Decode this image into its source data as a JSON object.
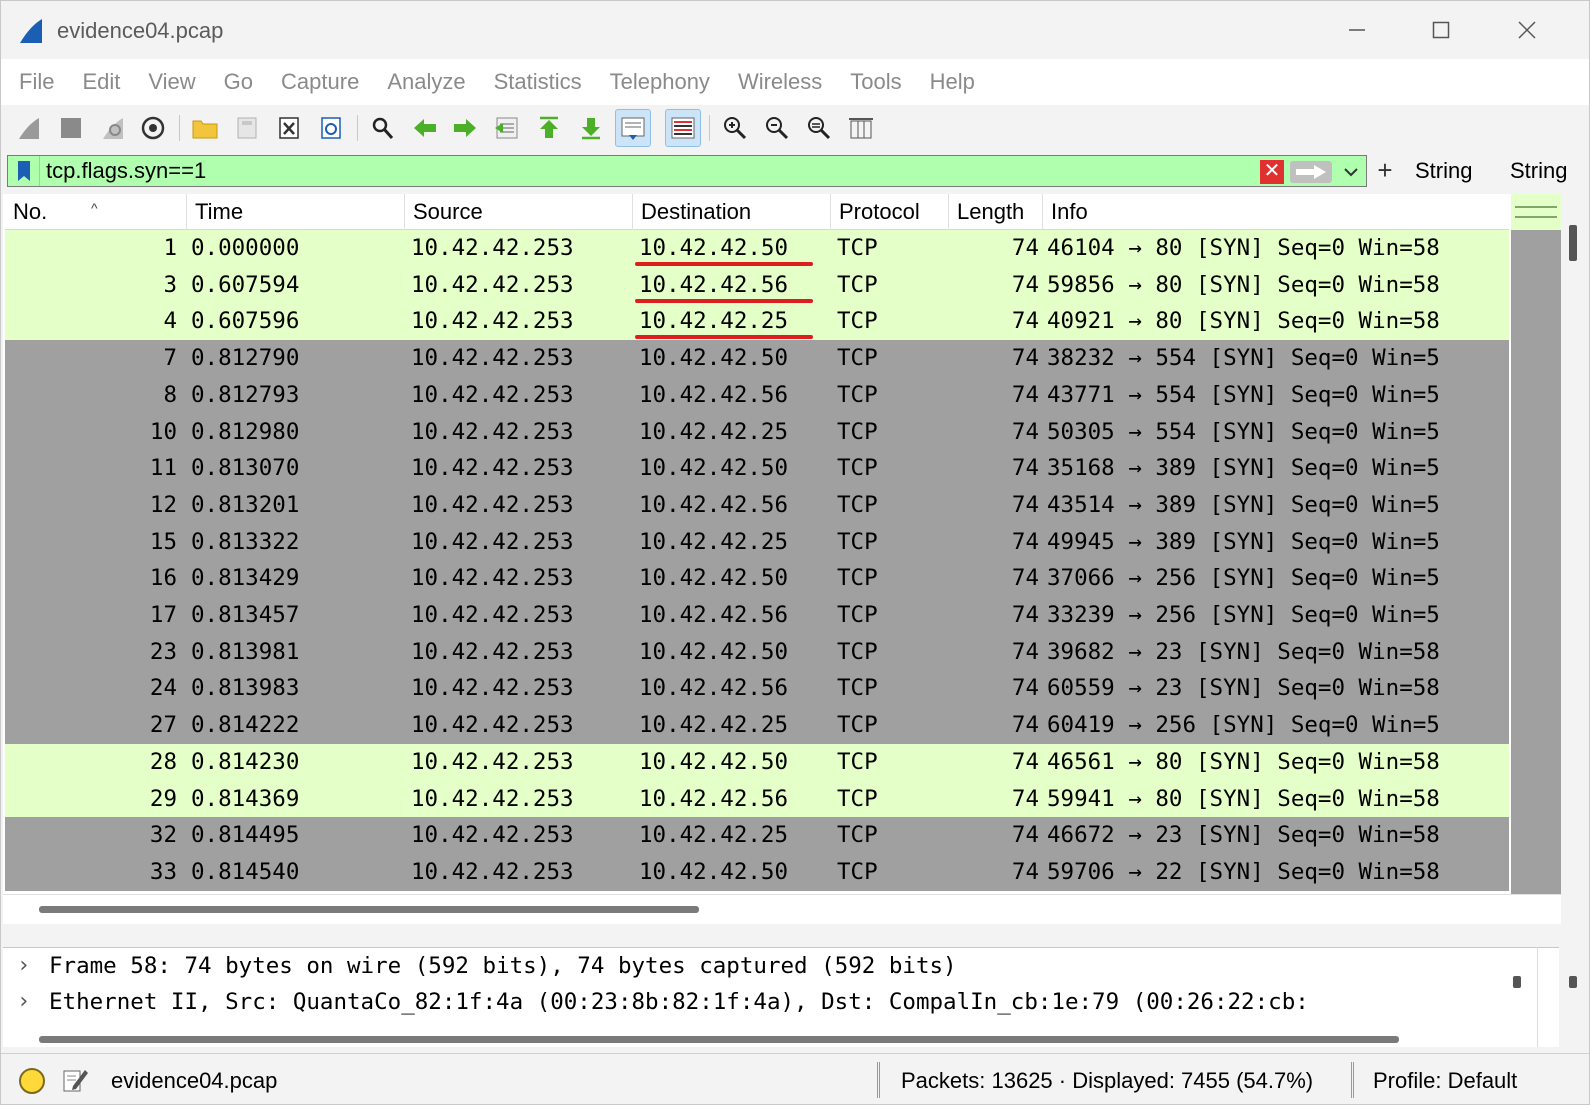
{
  "window": {
    "title": "evidence04.pcap"
  },
  "menu": [
    "File",
    "Edit",
    "View",
    "Go",
    "Capture",
    "Analyze",
    "Statistics",
    "Telephony",
    "Wireless",
    "Tools",
    "Help"
  ],
  "toolbar": {
    "icons": [
      "start-capture-icon",
      "stop-capture-icon",
      "restart-capture-icon",
      "capture-options-icon",
      "open-file-icon",
      "save-file-icon",
      "close-file-icon",
      "reload-file-icon",
      "find-packet-icon",
      "go-back-icon",
      "go-forward-icon",
      "go-to-packet-icon",
      "first-packet-icon",
      "last-packet-icon",
      "auto-scroll-icon",
      "colorize-icon",
      "zoom-in-icon",
      "zoom-out-icon",
      "normal-size-icon",
      "resize-columns-icon"
    ]
  },
  "filter": {
    "value": "tcp.flags.syn==1",
    "clear_symbol": "✕",
    "plus": "+",
    "buttons": [
      "String",
      "String"
    ]
  },
  "columns": [
    "No.",
    "Time",
    "Source",
    "Destination",
    "Protocol",
    "Length",
    "Info"
  ],
  "packets": [
    {
      "no": "1",
      "time": "0.000000",
      "src": "10.42.42.253",
      "dst": "10.42.42.50",
      "proto": "TCP",
      "len": "74",
      "info": "46104 → 80 [SYN] Seq=0 Win=58",
      "color": "light-green",
      "dst_underlined": true
    },
    {
      "no": "3",
      "time": "0.607594",
      "src": "10.42.42.253",
      "dst": "10.42.42.56",
      "proto": "TCP",
      "len": "74",
      "info": "59856 → 80 [SYN] Seq=0 Win=58",
      "color": "light-green",
      "dst_underlined": true
    },
    {
      "no": "4",
      "time": "0.607596",
      "src": "10.42.42.253",
      "dst": "10.42.42.25",
      "proto": "TCP",
      "len": "74",
      "info": "40921 → 80 [SYN] Seq=0 Win=58",
      "color": "light-green",
      "dst_underlined": true
    },
    {
      "no": "7",
      "time": "0.812790",
      "src": "10.42.42.253",
      "dst": "10.42.42.50",
      "proto": "TCP",
      "len": "74",
      "info": "38232 → 554 [SYN] Seq=0 Win=5",
      "color": "gray",
      "dst_underlined": false
    },
    {
      "no": "8",
      "time": "0.812793",
      "src": "10.42.42.253",
      "dst": "10.42.42.56",
      "proto": "TCP",
      "len": "74",
      "info": "43771 → 554 [SYN] Seq=0 Win=5",
      "color": "gray",
      "dst_underlined": false
    },
    {
      "no": "10",
      "time": "0.812980",
      "src": "10.42.42.253",
      "dst": "10.42.42.25",
      "proto": "TCP",
      "len": "74",
      "info": "50305 → 554 [SYN] Seq=0 Win=5",
      "color": "gray",
      "dst_underlined": false
    },
    {
      "no": "11",
      "time": "0.813070",
      "src": "10.42.42.253",
      "dst": "10.42.42.50",
      "proto": "TCP",
      "len": "74",
      "info": "35168 → 389 [SYN] Seq=0 Win=5",
      "color": "gray",
      "dst_underlined": false
    },
    {
      "no": "12",
      "time": "0.813201",
      "src": "10.42.42.253",
      "dst": "10.42.42.56",
      "proto": "TCP",
      "len": "74",
      "info": "43514 → 389 [SYN] Seq=0 Win=5",
      "color": "gray",
      "dst_underlined": false
    },
    {
      "no": "15",
      "time": "0.813322",
      "src": "10.42.42.253",
      "dst": "10.42.42.25",
      "proto": "TCP",
      "len": "74",
      "info": "49945 → 389 [SYN] Seq=0 Win=5",
      "color": "gray",
      "dst_underlined": false
    },
    {
      "no": "16",
      "time": "0.813429",
      "src": "10.42.42.253",
      "dst": "10.42.42.50",
      "proto": "TCP",
      "len": "74",
      "info": "37066 → 256 [SYN] Seq=0 Win=5",
      "color": "gray",
      "dst_underlined": false
    },
    {
      "no": "17",
      "time": "0.813457",
      "src": "10.42.42.253",
      "dst": "10.42.42.56",
      "proto": "TCP",
      "len": "74",
      "info": "33239 → 256 [SYN] Seq=0 Win=5",
      "color": "gray",
      "dst_underlined": false
    },
    {
      "no": "23",
      "time": "0.813981",
      "src": "10.42.42.253",
      "dst": "10.42.42.50",
      "proto": "TCP",
      "len": "74",
      "info": "39682 → 23 [SYN] Seq=0 Win=58",
      "color": "gray",
      "dst_underlined": false
    },
    {
      "no": "24",
      "time": "0.813983",
      "src": "10.42.42.253",
      "dst": "10.42.42.56",
      "proto": "TCP",
      "len": "74",
      "info": "60559 → 23 [SYN] Seq=0 Win=58",
      "color": "gray",
      "dst_underlined": false
    },
    {
      "no": "27",
      "time": "0.814222",
      "src": "10.42.42.253",
      "dst": "10.42.42.25",
      "proto": "TCP",
      "len": "74",
      "info": "60419 → 256 [SYN] Seq=0 Win=5",
      "color": "gray",
      "dst_underlined": false
    },
    {
      "no": "28",
      "time": "0.814230",
      "src": "10.42.42.253",
      "dst": "10.42.42.50",
      "proto": "TCP",
      "len": "74",
      "info": "46561 → 80 [SYN] Seq=0 Win=58",
      "color": "light-green",
      "dst_underlined": false
    },
    {
      "no": "29",
      "time": "0.814369",
      "src": "10.42.42.253",
      "dst": "10.42.42.56",
      "proto": "TCP",
      "len": "74",
      "info": "59941 → 80 [SYN] Seq=0 Win=58",
      "color": "light-green",
      "dst_underlined": false
    },
    {
      "no": "32",
      "time": "0.814495",
      "src": "10.42.42.253",
      "dst": "10.42.42.25",
      "proto": "TCP",
      "len": "74",
      "info": "46672 → 23 [SYN] Seq=0 Win=58",
      "color": "gray",
      "dst_underlined": false
    },
    {
      "no": "33",
      "time": "0.814540",
      "src": "10.42.42.253",
      "dst": "10.42.42.50",
      "proto": "TCP",
      "len": "74",
      "info": "59706 → 22 [SYN] Seq=0 Win=58",
      "color": "gray",
      "dst_underlined": false
    }
  ],
  "details": [
    {
      "chevron": "›",
      "text": "Frame 58: 74 bytes on wire (592 bits), 74 bytes captured (592 bits)"
    },
    {
      "chevron": "›",
      "text": "Ethernet II, Src: QuantaCo_82:1f:4a (00:23:8b:82:1f:4a), Dst: CompalIn_cb:1e:79 (00:26:22:cb:"
    }
  ],
  "status": {
    "file": "evidence04.pcap",
    "packets": "Packets: 13625 · Displayed: 7455 (54.7%)",
    "profile": "Profile: Default"
  },
  "colors": {
    "syn_row": "#e4ffc7",
    "other_row": "#a0a0a0",
    "filter_valid": "#afffaf",
    "annotation_underline": "#dc1e1e"
  }
}
